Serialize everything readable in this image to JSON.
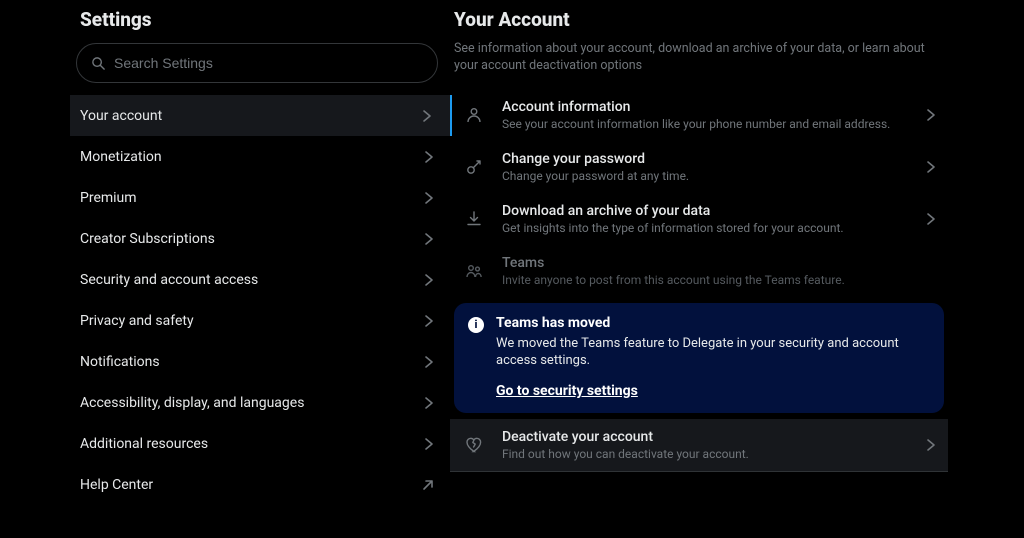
{
  "sidebar": {
    "title": "Settings",
    "search_placeholder": "Search Settings",
    "items": [
      {
        "label": "Your account",
        "active": true,
        "kind": "chev"
      },
      {
        "label": "Monetization",
        "active": false,
        "kind": "chev"
      },
      {
        "label": "Premium",
        "active": false,
        "kind": "chev"
      },
      {
        "label": "Creator Subscriptions",
        "active": false,
        "kind": "chev"
      },
      {
        "label": "Security and account access",
        "active": false,
        "kind": "chev"
      },
      {
        "label": "Privacy and safety",
        "active": false,
        "kind": "chev"
      },
      {
        "label": "Notifications",
        "active": false,
        "kind": "chev"
      },
      {
        "label": "Accessibility, display, and languages",
        "active": false,
        "kind": "chev"
      },
      {
        "label": "Additional resources",
        "active": false,
        "kind": "chev"
      },
      {
        "label": "Help Center",
        "active": false,
        "kind": "ext"
      }
    ]
  },
  "main": {
    "title": "Your Account",
    "description": "See information about your account, download an archive of your data, or learn about your account deactivation options",
    "rows": [
      {
        "icon": "person",
        "title": "Account information",
        "sub": "See your account information like your phone number and email address.",
        "chev": true,
        "disabled": false
      },
      {
        "icon": "key",
        "title": "Change your password",
        "sub": "Change your password at any time.",
        "chev": true,
        "disabled": false
      },
      {
        "icon": "download",
        "title": "Download an archive of your data",
        "sub": "Get insights into the type of information stored for your account.",
        "chev": true,
        "disabled": false
      },
      {
        "icon": "team",
        "title": "Teams",
        "sub": "Invite anyone to post from this account using the Teams feature.",
        "chev": false,
        "disabled": true
      }
    ],
    "notice": {
      "title": "Teams has moved",
      "body": "We moved the Teams feature to Delegate in your security and account access settings.",
      "link": "Go to security settings"
    },
    "deactivate": {
      "icon": "heartbreak",
      "title": "Deactivate your account",
      "sub": "Find out how you can deactivate your account."
    }
  }
}
